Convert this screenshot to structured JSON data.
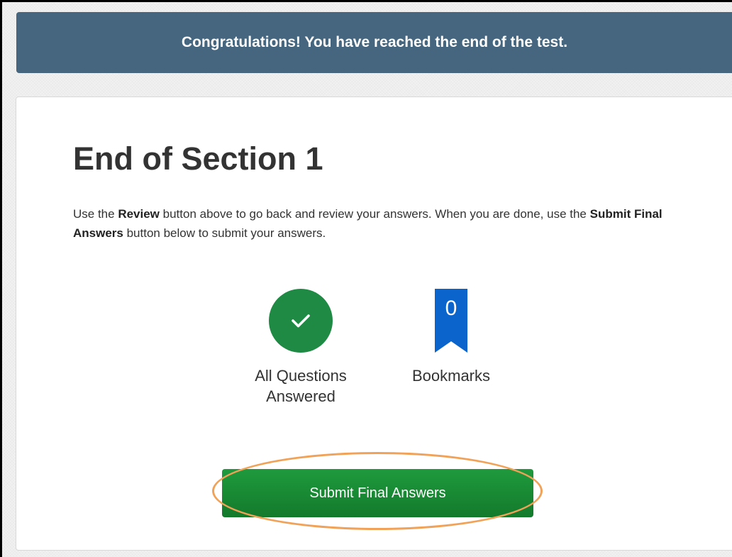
{
  "banner": {
    "message": "Congratulations! You have reached the end of the test."
  },
  "section": {
    "title": "End of Section 1",
    "instructions": {
      "part1": "Use the ",
      "review_label": "Review",
      "part2": " button above to go back and review your answers. When you are done, use the ",
      "submit_label": "Submit Final Answers",
      "part3": " button below to submit your answers."
    }
  },
  "stats": {
    "answered": {
      "icon": "check-icon",
      "label": "All Questions Answered",
      "color": "#1e8a44"
    },
    "bookmarks": {
      "icon": "bookmark-icon",
      "count": "0",
      "label": "Bookmarks",
      "color": "#0a64cc"
    }
  },
  "submit_button": {
    "label": "Submit Final Answers",
    "color": "#1a8a36"
  },
  "highlight": {
    "color": "#f0a258"
  }
}
